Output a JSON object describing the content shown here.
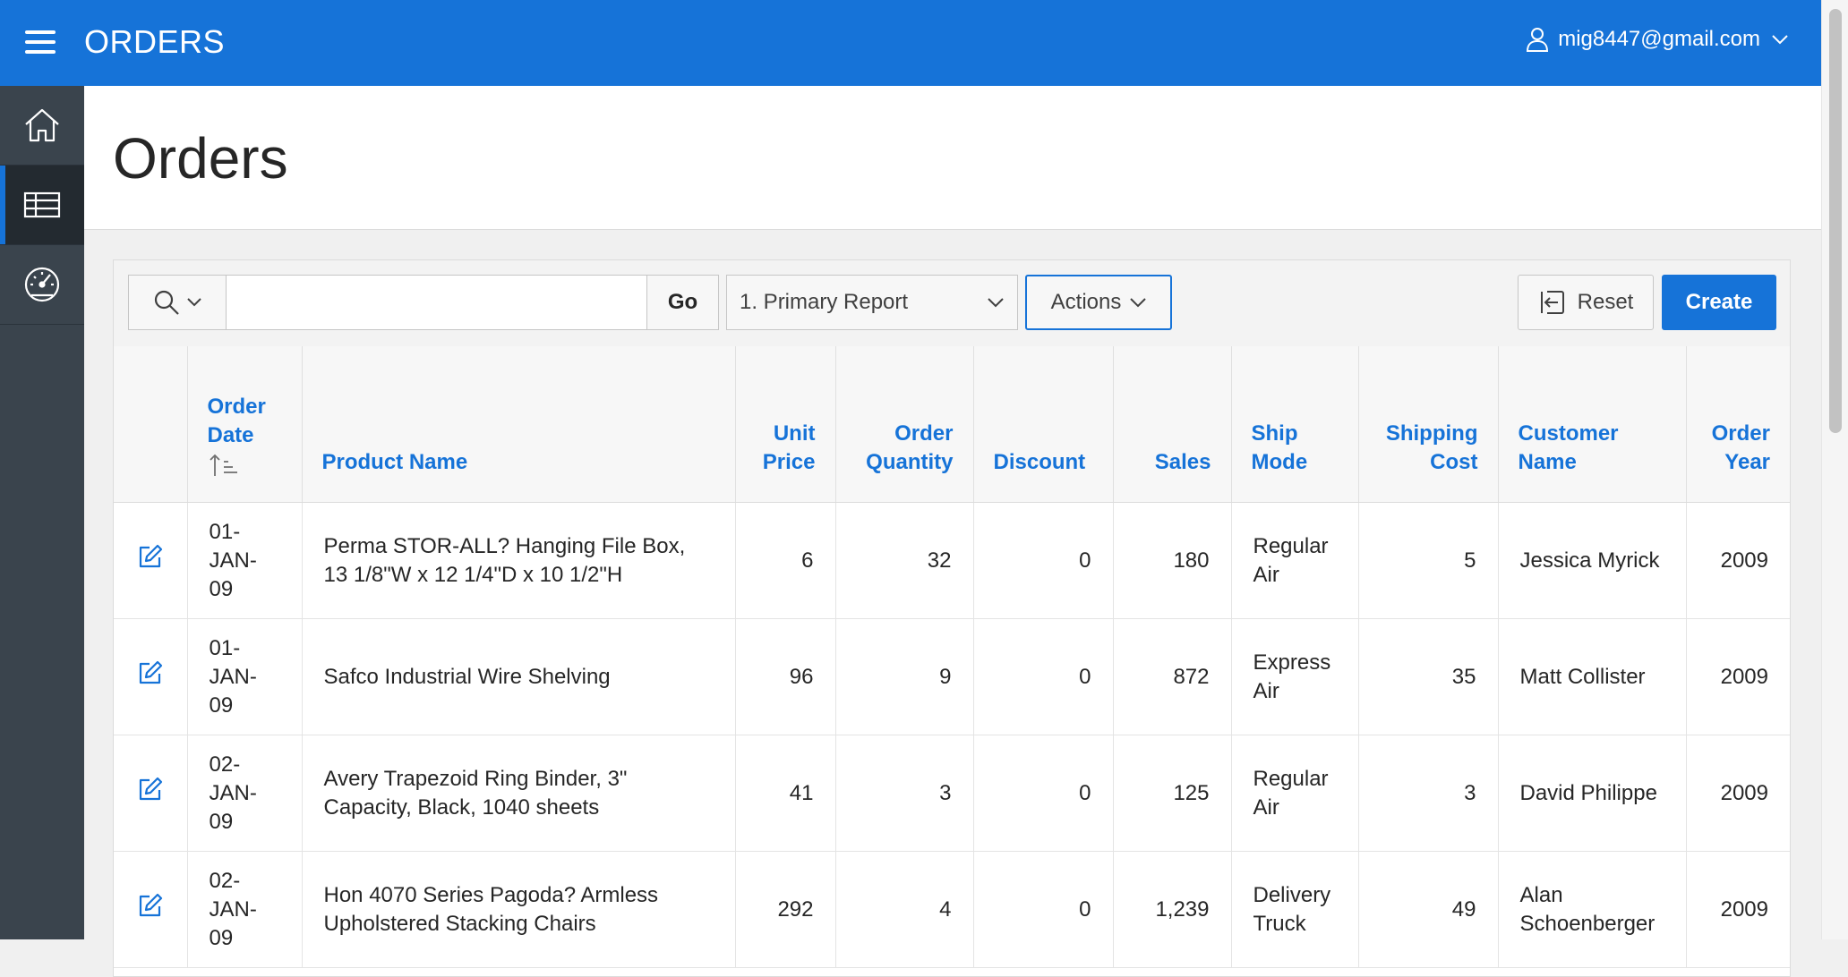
{
  "header": {
    "app_title": "ORDERS",
    "user_email": "mig8447@gmail.com",
    "icons": {
      "menu": "hamburger-menu-icon",
      "user": "user-icon",
      "dropdown": "chevron-down-icon"
    }
  },
  "sidebar": {
    "items": [
      {
        "name": "home",
        "icon": "home-icon",
        "active": false
      },
      {
        "name": "orders",
        "icon": "table-icon",
        "active": true
      },
      {
        "name": "dashboard",
        "icon": "dashboard-gauge-icon",
        "active": false
      }
    ]
  },
  "page": {
    "title": "Orders"
  },
  "toolbar": {
    "search_value": "",
    "go_label": "Go",
    "report_selected": "1. Primary Report",
    "actions_label": "Actions",
    "reset_label": "Reset",
    "create_label": "Create"
  },
  "table": {
    "columns": [
      {
        "key": "edit",
        "label": ""
      },
      {
        "key": "order_date",
        "label": "Order Date",
        "sorted": "ascending"
      },
      {
        "key": "product_name",
        "label": "Product Name"
      },
      {
        "key": "unit_price",
        "label": "Unit Price"
      },
      {
        "key": "order_quantity",
        "label": "Order Quantity"
      },
      {
        "key": "discount",
        "label": "Discount"
      },
      {
        "key": "sales",
        "label": "Sales"
      },
      {
        "key": "ship_mode",
        "label": "Ship Mode"
      },
      {
        "key": "shipping_cost",
        "label": "Shipping Cost"
      },
      {
        "key": "customer_name",
        "label": "Customer Name"
      },
      {
        "key": "order_year",
        "label": "Order Year"
      }
    ],
    "rows": [
      {
        "order_date": "01-JAN-09",
        "product_name": "Perma STOR-ALL? Hanging File Box, 13 1/8\"W x 12 1/4\"D x 10 1/2\"H",
        "unit_price": "6",
        "order_quantity": "32",
        "discount": "0",
        "sales": "180",
        "ship_mode": "Regular Air",
        "shipping_cost": "5",
        "customer_name": "Jessica Myrick",
        "order_year": "2009"
      },
      {
        "order_date": "01-JAN-09",
        "product_name": "Safco Industrial Wire Shelving",
        "unit_price": "96",
        "order_quantity": "9",
        "discount": "0",
        "sales": "872",
        "ship_mode": "Express Air",
        "shipping_cost": "35",
        "customer_name": "Matt Collister",
        "order_year": "2009"
      },
      {
        "order_date": "02-JAN-09",
        "product_name": "Avery Trapezoid Ring Binder, 3\" Capacity, Black, 1040 sheets",
        "unit_price": "41",
        "order_quantity": "3",
        "discount": "0",
        "sales": "125",
        "ship_mode": "Regular Air",
        "shipping_cost": "3",
        "customer_name": "David Philippe",
        "order_year": "2009"
      },
      {
        "order_date": "02-JAN-09",
        "product_name": "Hon 4070 Series Pagoda? Armless Upholstered Stacking Chairs",
        "unit_price": "292",
        "order_quantity": "4",
        "discount": "0",
        "sales": "1,239",
        "ship_mode": "Delivery Truck",
        "shipping_cost": "49",
        "customer_name": "Alan Schoenberger",
        "order_year": "2009"
      }
    ]
  },
  "colors": {
    "accent": "#1673d8",
    "sidebar": "#3a444d",
    "sidebar_active": "#232a30"
  }
}
